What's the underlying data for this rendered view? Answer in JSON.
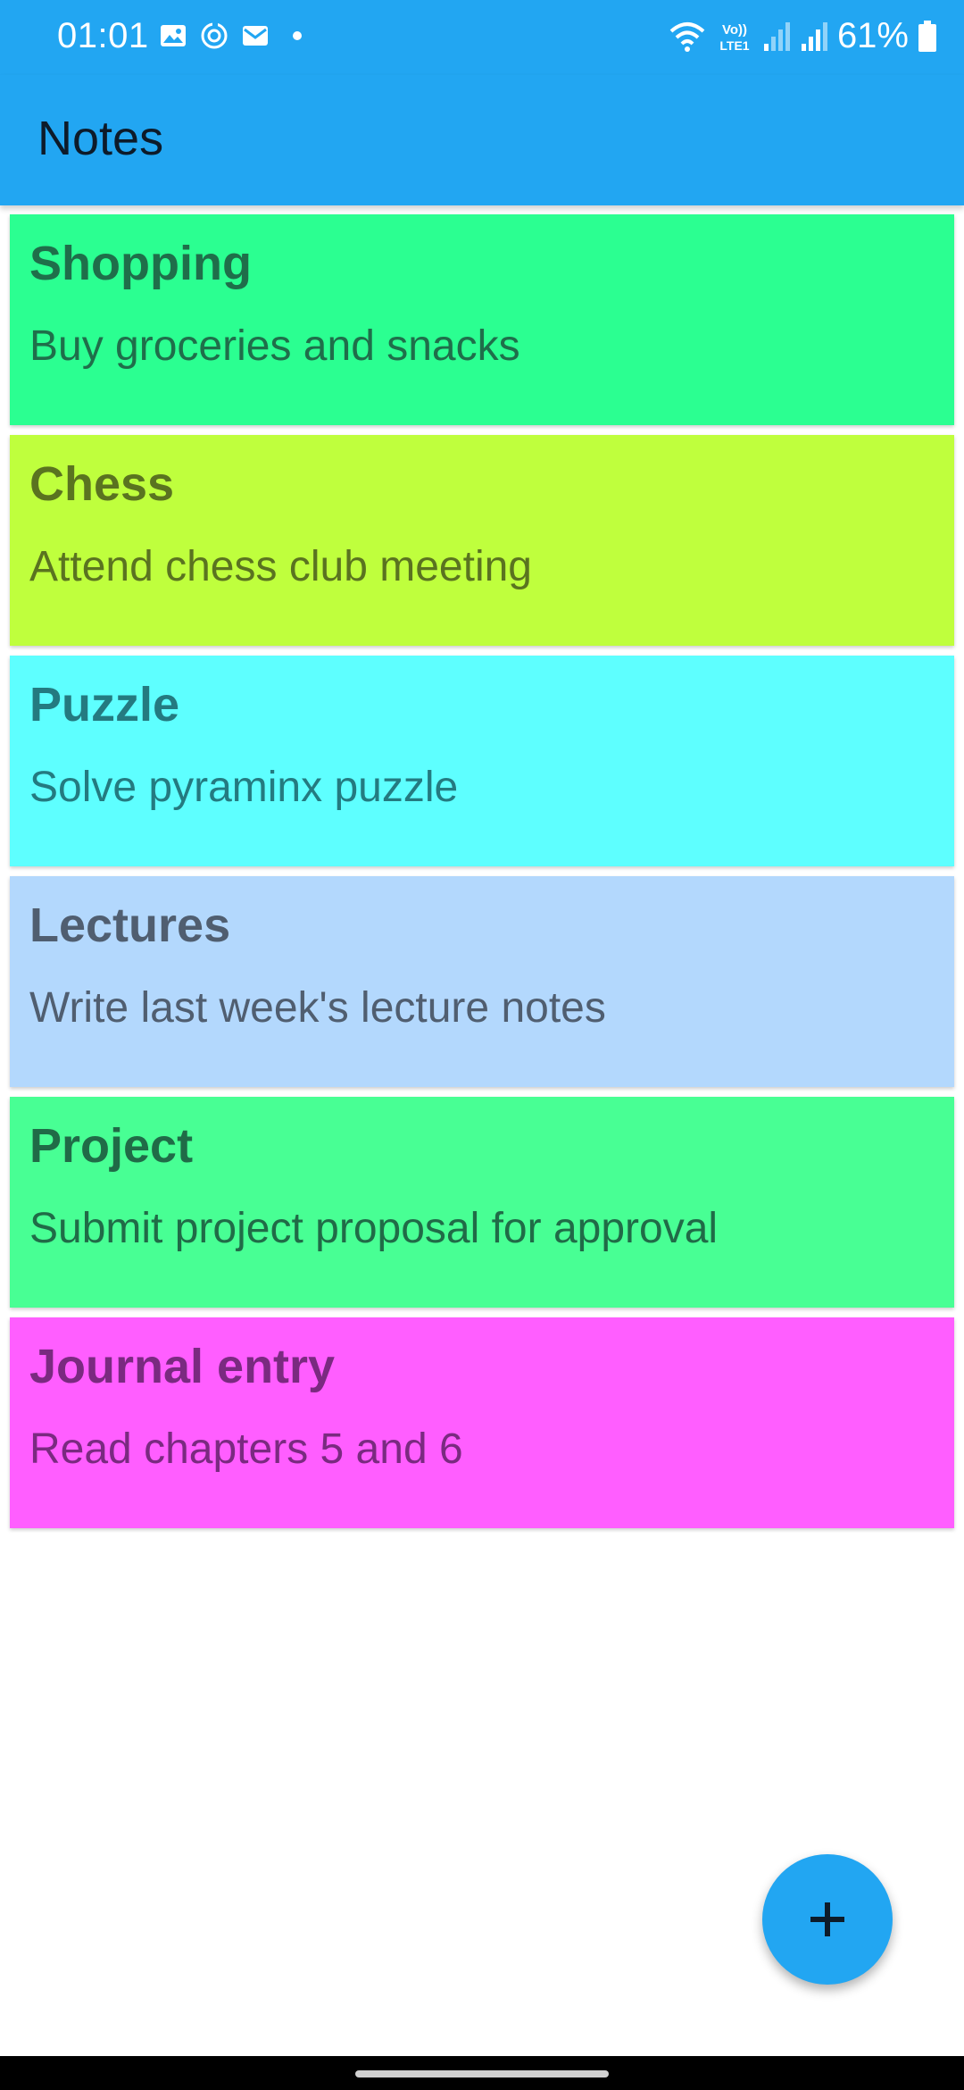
{
  "status_bar": {
    "time": "01:01",
    "battery_percent": "61%",
    "network_label": "VoLTE1"
  },
  "app_bar": {
    "title": "Notes"
  },
  "notes": [
    {
      "title": "Shopping",
      "body": "Buy groceries and snacks",
      "bg": "#2bff91",
      "fg": "#1f6e4a"
    },
    {
      "title": "Chess",
      "body": "Attend chess club meeting",
      "bg": "#bfff3d",
      "fg": "#5a7320"
    },
    {
      "title": "Puzzle",
      "body": "Solve pyraminx puzzle",
      "bg": "#5effff",
      "fg": "#247a80"
    },
    {
      "title": "Lectures",
      "body": "Write last week's lecture notes",
      "bg": "#b3d8fd",
      "fg": "#505e70"
    },
    {
      "title": "Project",
      "body": "Submit project proposal for approval",
      "bg": "#48ff94",
      "fg": "#206b47"
    },
    {
      "title": "Journal entry",
      "body": "Read chapters 5 and 6",
      "bg": "#ff5eff",
      "fg": "#7a2a80"
    }
  ],
  "fab": {
    "icon": "plus-icon"
  },
  "colors": {
    "primary": "#22a6f2"
  }
}
